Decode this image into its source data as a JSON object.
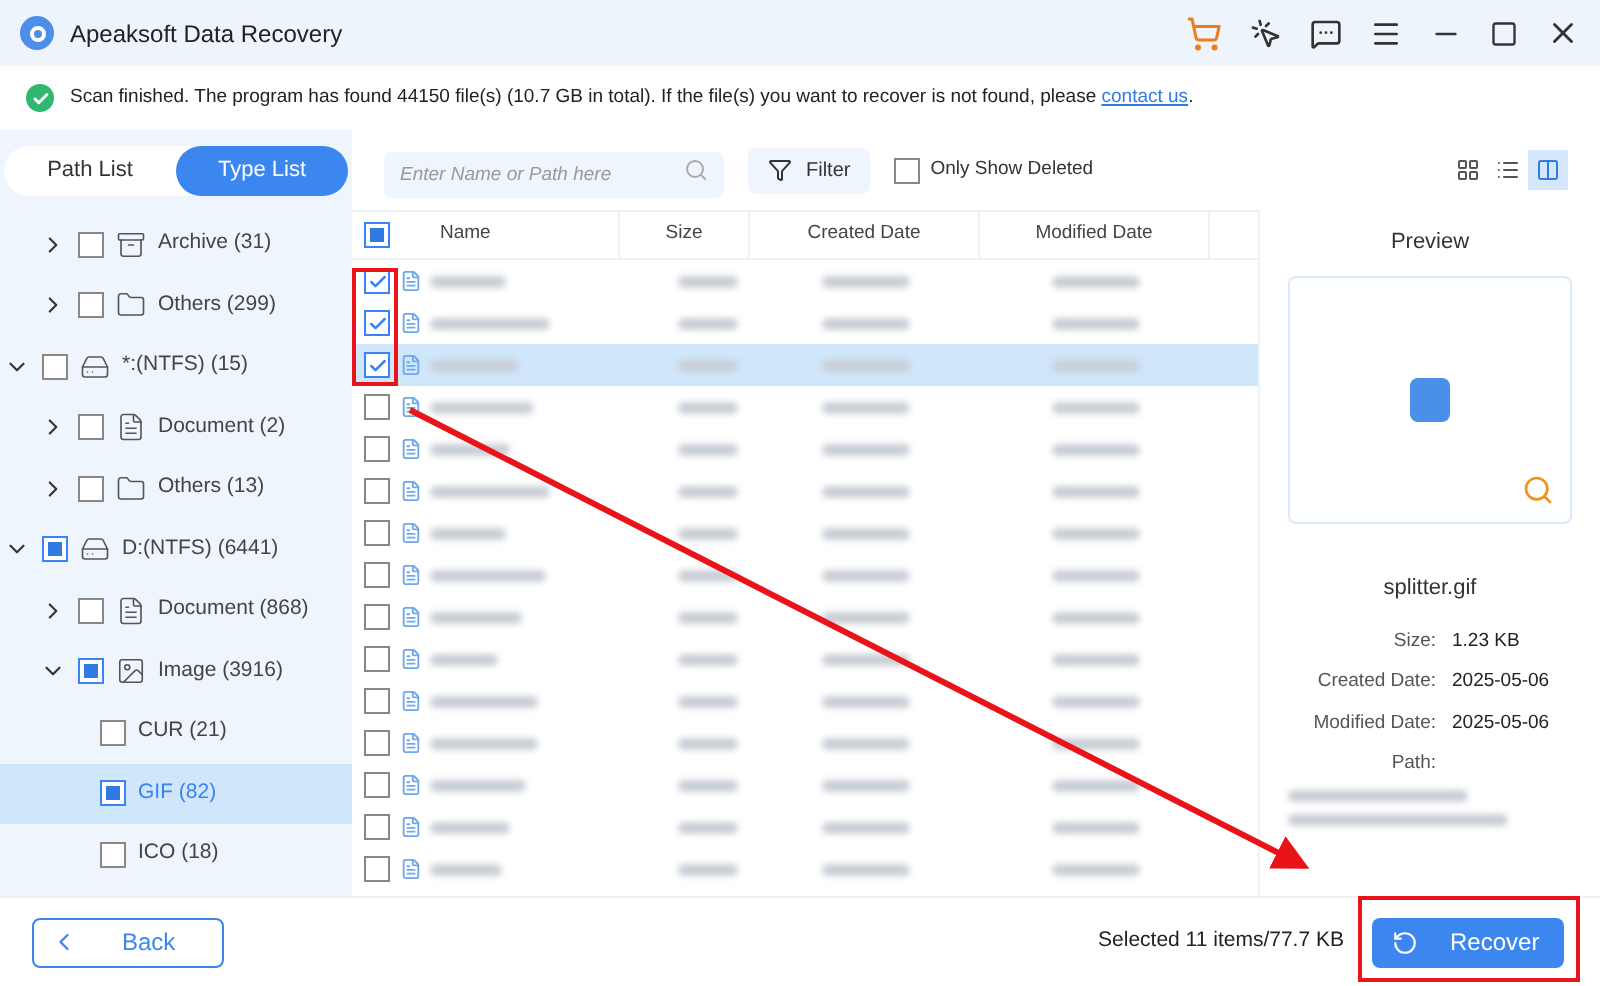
{
  "window": {
    "title": "Apeaksoft Data Recovery"
  },
  "status": {
    "message": "Scan finished. The program has found 44150 file(s) (10.7 GB in total). If the file(s) you want to recover is not found, please",
    "link": "contact us",
    "end": "."
  },
  "view_tabs": [
    {
      "label": "Path List",
      "selected": false
    },
    {
      "label": "Type List",
      "selected": true
    }
  ],
  "search": {
    "placeholder": "Enter Name or Path here"
  },
  "filter": {
    "label": "Filter"
  },
  "only_deleted": {
    "label": "Only Show Deleted",
    "checked": false
  },
  "layout_modes": [
    {
      "kind": "grid",
      "selected": false
    },
    {
      "kind": "list",
      "selected": false
    },
    {
      "kind": "preview",
      "selected": true
    }
  ],
  "tree": [
    {
      "children": [
        {
          "label": "Archive (31)",
          "kind": "archive",
          "expanded": false,
          "checked": false,
          "selected": false
        },
        {
          "label": "Others (299)",
          "kind": "folder",
          "expanded": false,
          "checked": false,
          "selected": false
        }
      ]
    },
    {
      "label": "*:(NTFS) (15)",
      "kind": "drive",
      "expanded": true,
      "checked": false,
      "selected": false,
      "children": [
        {
          "label": "Document (2)",
          "kind": "document",
          "expanded": false,
          "checked": false,
          "selected": false
        },
        {
          "label": "Others (13)",
          "kind": "folder",
          "expanded": false,
          "checked": false,
          "selected": false
        }
      ]
    },
    {
      "label": "D:(NTFS) (6441)",
      "kind": "drive",
      "expanded": true,
      "checked": true,
      "selected": false,
      "children": [
        {
          "label": "Document (868)",
          "kind": "document",
          "expanded": false,
          "checked": false,
          "selected": false
        },
        {
          "label": "Image (3916)",
          "kind": "image",
          "expanded": true,
          "checked": true,
          "selected": false,
          "children": [
            {
              "label": "CUR (21)",
              "kind": "type",
              "checked": false,
              "selected": false
            },
            {
              "label": "GIF (82)",
              "kind": "type",
              "checked": true,
              "selected": true
            },
            {
              "label": "ICO (18)",
              "kind": "type",
              "checked": false,
              "selected": false
            }
          ]
        }
      ]
    }
  ],
  "table": {
    "select_all": {
      "checked": true
    },
    "columns": [
      "Name",
      "Size",
      "Created Date",
      "Modified Date"
    ],
    "rows": [
      {
        "checked": true,
        "selected": false
      },
      {
        "checked": true,
        "selected": false
      },
      {
        "checked": true,
        "selected": true
      },
      {
        "checked": false,
        "selected": false
      },
      {
        "checked": false,
        "selected": false
      },
      {
        "checked": false,
        "selected": false
      },
      {
        "checked": false,
        "selected": false
      },
      {
        "checked": false,
        "selected": false
      },
      {
        "checked": false,
        "selected": false
      },
      {
        "checked": false,
        "selected": false
      },
      {
        "checked": false,
        "selected": false
      },
      {
        "checked": false,
        "selected": false
      },
      {
        "checked": false,
        "selected": false
      },
      {
        "checked": false,
        "selected": false
      },
      {
        "checked": false,
        "selected": false
      }
    ]
  },
  "preview": {
    "title": "Preview",
    "file_name": "splitter.gif",
    "details": [
      {
        "label": "Size:",
        "value": "1.23 KB"
      },
      {
        "label": "Created Date:",
        "value": "2025-05-06"
      },
      {
        "label": "Modified Date:",
        "value": "2025-05-06"
      },
      {
        "label": "Path:"
      }
    ]
  },
  "footer": {
    "back": "Back",
    "selection": "Selected 11 items/77.7 KB",
    "recover": "Recover"
  }
}
